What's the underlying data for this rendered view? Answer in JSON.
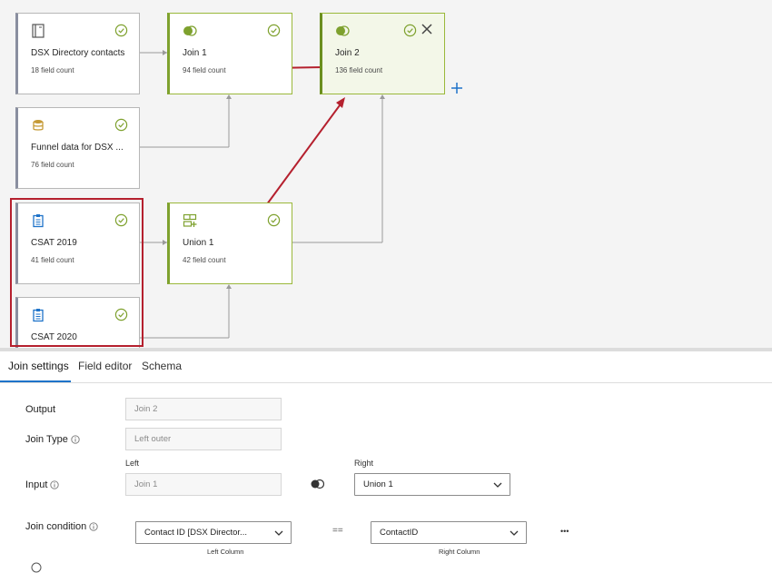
{
  "canvas": {
    "nodes": [
      {
        "id": "dsx",
        "title": "DSX Directory contacts",
        "count": "18 field count",
        "icon": "directory-icon"
      },
      {
        "id": "join1",
        "title": "Join 1",
        "count": "94 field count",
        "icon": "join-icon"
      },
      {
        "id": "join2",
        "title": "Join 2",
        "count": "136 field count",
        "icon": "join-icon"
      },
      {
        "id": "funnel",
        "title": "Funnel data for DSX ...",
        "count": "76 field count",
        "icon": "database-icon"
      },
      {
        "id": "csat2019",
        "title": "CSAT 2019",
        "count": "41 field count",
        "icon": "survey-icon"
      },
      {
        "id": "union1",
        "title": "Union 1",
        "count": "42 field count",
        "icon": "union-icon"
      },
      {
        "id": "csat2020",
        "title": "CSAT 2020",
        "count": "",
        "icon": "survey-icon"
      }
    ],
    "colors": {
      "accent_green": "#7ea12e",
      "annotation_red": "#b5202e",
      "link_blue": "#1e73c9"
    }
  },
  "tabs": [
    {
      "label": "Join settings",
      "active": true
    },
    {
      "label": "Field editor",
      "active": false
    },
    {
      "label": "Schema",
      "active": false
    }
  ],
  "form": {
    "output_label": "Output",
    "output_value": "Join 2",
    "join_type_label": "Join Type",
    "join_type_value": "Left outer",
    "input_label": "Input",
    "left_label": "Left",
    "right_label": "Right",
    "left_value": "Join 1",
    "right_value": "Union 1",
    "join_condition_label": "Join condition",
    "left_column_value": "Contact ID [DSX Director...",
    "operator": "==",
    "right_column_value": "ContactID",
    "left_column_caption": "Left Column",
    "right_column_caption": "Right Column",
    "more_label": "•••"
  }
}
